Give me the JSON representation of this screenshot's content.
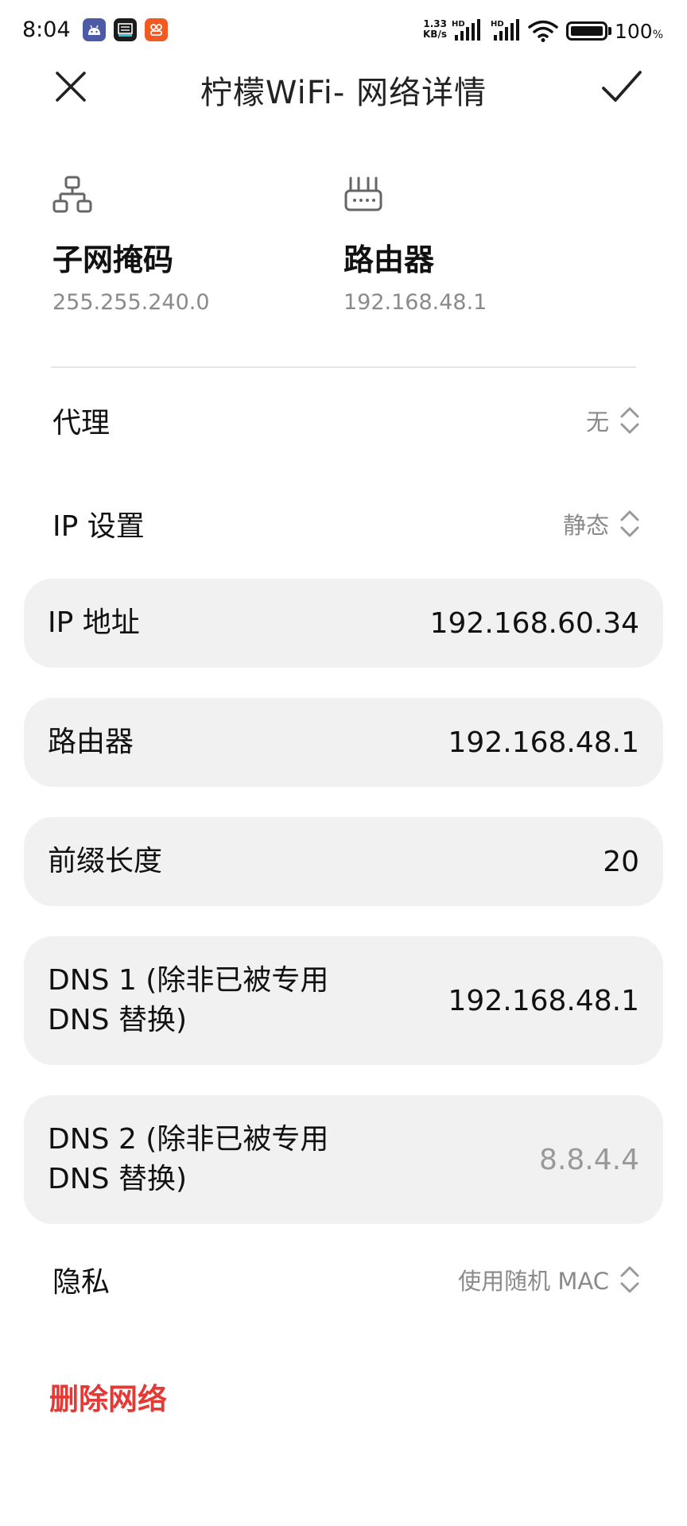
{
  "status_bar": {
    "time": "8:04",
    "speed_value": "1.33",
    "speed_unit": "KB/s",
    "signal_1_label": "HD",
    "signal_2_label": "HD",
    "battery_percent": "100",
    "battery_unit": "%",
    "battery_level": 1.0
  },
  "header": {
    "title": "柠檬WiFi- 网络详情",
    "close_icon": "close-icon",
    "confirm_icon": "check-icon"
  },
  "summary": {
    "subnet": {
      "icon": "network-topology-icon",
      "label": "子网掩码",
      "value": "255.255.240.0"
    },
    "router": {
      "icon": "router-icon",
      "label": "路由器",
      "value": "192.168.48.1"
    }
  },
  "settings": {
    "proxy": {
      "label": "代理",
      "value": "无"
    },
    "ip_settings": {
      "label": "IP 设置",
      "value": "静态"
    },
    "privacy": {
      "label": "隐私",
      "value": "使用随机 MAC"
    }
  },
  "fields": {
    "ip_address": {
      "label": "IP 地址",
      "value": "192.168.60.34"
    },
    "gateway": {
      "label": "路由器",
      "value": "192.168.48.1"
    },
    "prefix_length": {
      "label": "前缀长度",
      "value": "20"
    },
    "dns1": {
      "label_line1": "DNS 1 (除非已被专用",
      "label_line2": "DNS 替换)",
      "value": "192.168.48.1"
    },
    "dns2": {
      "label_line1": "DNS 2 (除非已被专用",
      "label_line2": "DNS 替换)",
      "placeholder": "8.8.4.4"
    }
  },
  "actions": {
    "delete_network": "删除网络"
  },
  "colors": {
    "danger": "#e53935",
    "card_background": "#f1f1f1",
    "secondary_text": "#8a8a8a"
  }
}
